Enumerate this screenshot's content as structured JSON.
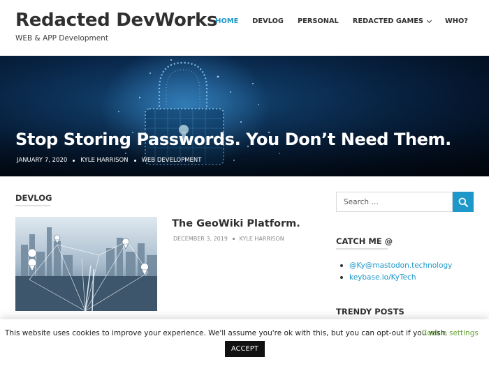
{
  "site": {
    "title": "Redacted DevWorks",
    "description": "WEB & APP Development"
  },
  "nav": {
    "items": [
      {
        "label": "HOME",
        "active": true
      },
      {
        "label": "DEVLOG"
      },
      {
        "label": "PERSONAL"
      },
      {
        "label": "REDACTED GAMES",
        "has_dropdown": true
      },
      {
        "label": "WHO?"
      }
    ],
    "accent_color": "#1e98c9"
  },
  "hero": {
    "title": "Stop Storing Passwords. You Don’t Need Them.",
    "date": "JANUARY 7, 2020",
    "author": "KYLE HARRISON",
    "category": "WEB DEVELOPMENT",
    "image_icon": "padlock-network-image"
  },
  "main": {
    "section_title": "DEVLOG",
    "post": {
      "title": "The GeoWiki Platform.",
      "date": "DECEMBER 3, 2019",
      "author": "KYLE HARRISON",
      "image_icon": "city-network-image"
    }
  },
  "sidebar": {
    "search": {
      "placeholder": "Search …",
      "icon": "search-icon"
    },
    "catch_me": {
      "title": "CATCH ME @",
      "links": [
        "@Ky@mastodon.technology",
        "keybase.io/KyTech"
      ]
    },
    "trendy": {
      "title": "TRENDY POSTS"
    }
  },
  "cookie": {
    "text": "This website uses cookies to improve your experience. We'll assume you're ok with this, but you can opt-out if you wish.",
    "settings_label": "Cookie settings",
    "accept_label": "ACCEPT",
    "settings_color": "#69a53c"
  }
}
